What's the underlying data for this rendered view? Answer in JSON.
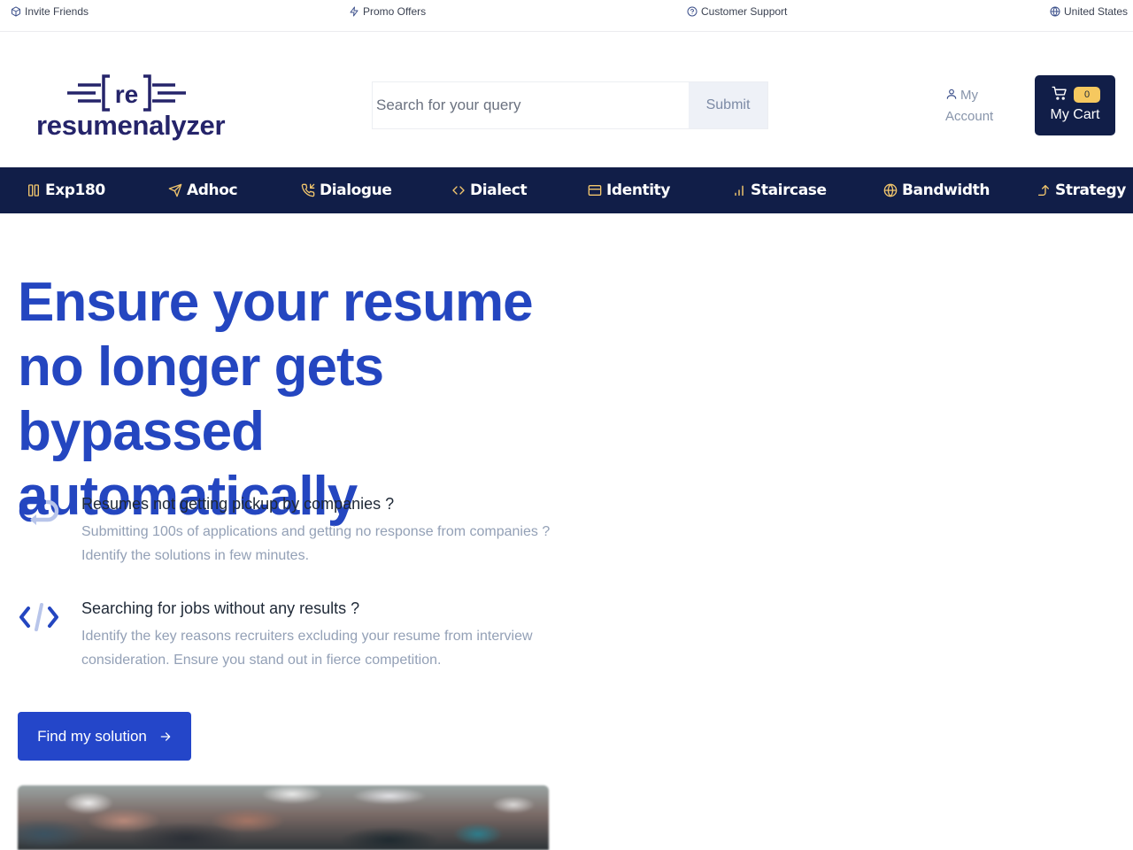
{
  "topbar": {
    "links": [
      {
        "label": "Invite Friends",
        "icon": "box-icon"
      },
      {
        "label": "Promo Offers",
        "icon": "lightning-icon"
      },
      {
        "label": "Customer Support",
        "icon": "help-circle-icon"
      },
      {
        "label": "United States",
        "icon": "globe-icon"
      }
    ]
  },
  "header": {
    "logo": {
      "mark_text": "re",
      "wordmark": "resumenalyzer",
      "color": "#25246a"
    },
    "search": {
      "placeholder": "Search for your query",
      "value": "",
      "submit_label": "Submit"
    },
    "account": {
      "label_line1": "My",
      "label_line2": "Account",
      "icon": "user-icon"
    },
    "cart": {
      "label": "My Cart",
      "count": "0",
      "icon": "cart-icon",
      "background": "#111e48",
      "badge_color": "#f6c85f"
    }
  },
  "nav": {
    "background": "#111e48",
    "icon_color": "#f2c66d",
    "items": [
      {
        "label": "Exp180",
        "icon": "columns-icon"
      },
      {
        "label": "Adhoc",
        "icon": "send-icon"
      },
      {
        "label": "Dialogue",
        "icon": "phone-incoming-icon"
      },
      {
        "label": "Dialect",
        "icon": "code-icon"
      },
      {
        "label": "Identity",
        "icon": "credit-card-icon"
      },
      {
        "label": "Staircase",
        "icon": "signal-bars-icon"
      },
      {
        "label": "Bandwidth",
        "icon": "globe-icon"
      },
      {
        "label": "Strategy",
        "icon": "corner-right-up-icon"
      }
    ]
  },
  "hero": {
    "title": "Ensure your resume no longer gets bypassed automatically",
    "title_color": "#2446c0",
    "features": [
      {
        "icon": "repeat-icon",
        "title": "Resumes not getting pickup by companies ?",
        "description": "Submitting 100s of applications and getting no response from companies ? Identify the solutions in few minutes."
      },
      {
        "icon": "code-slash-icon",
        "title": "Searching for jobs without any results ?",
        "description": "Identify the key reasons recruiters excluding your resume from interview consideration. Ensure you stand out in fierce competition."
      }
    ],
    "cta": {
      "label": "Find my solution",
      "icon": "arrow-right-icon",
      "color": "#2446c9"
    },
    "image": {
      "alt": "graduation-crowd-photo"
    }
  }
}
